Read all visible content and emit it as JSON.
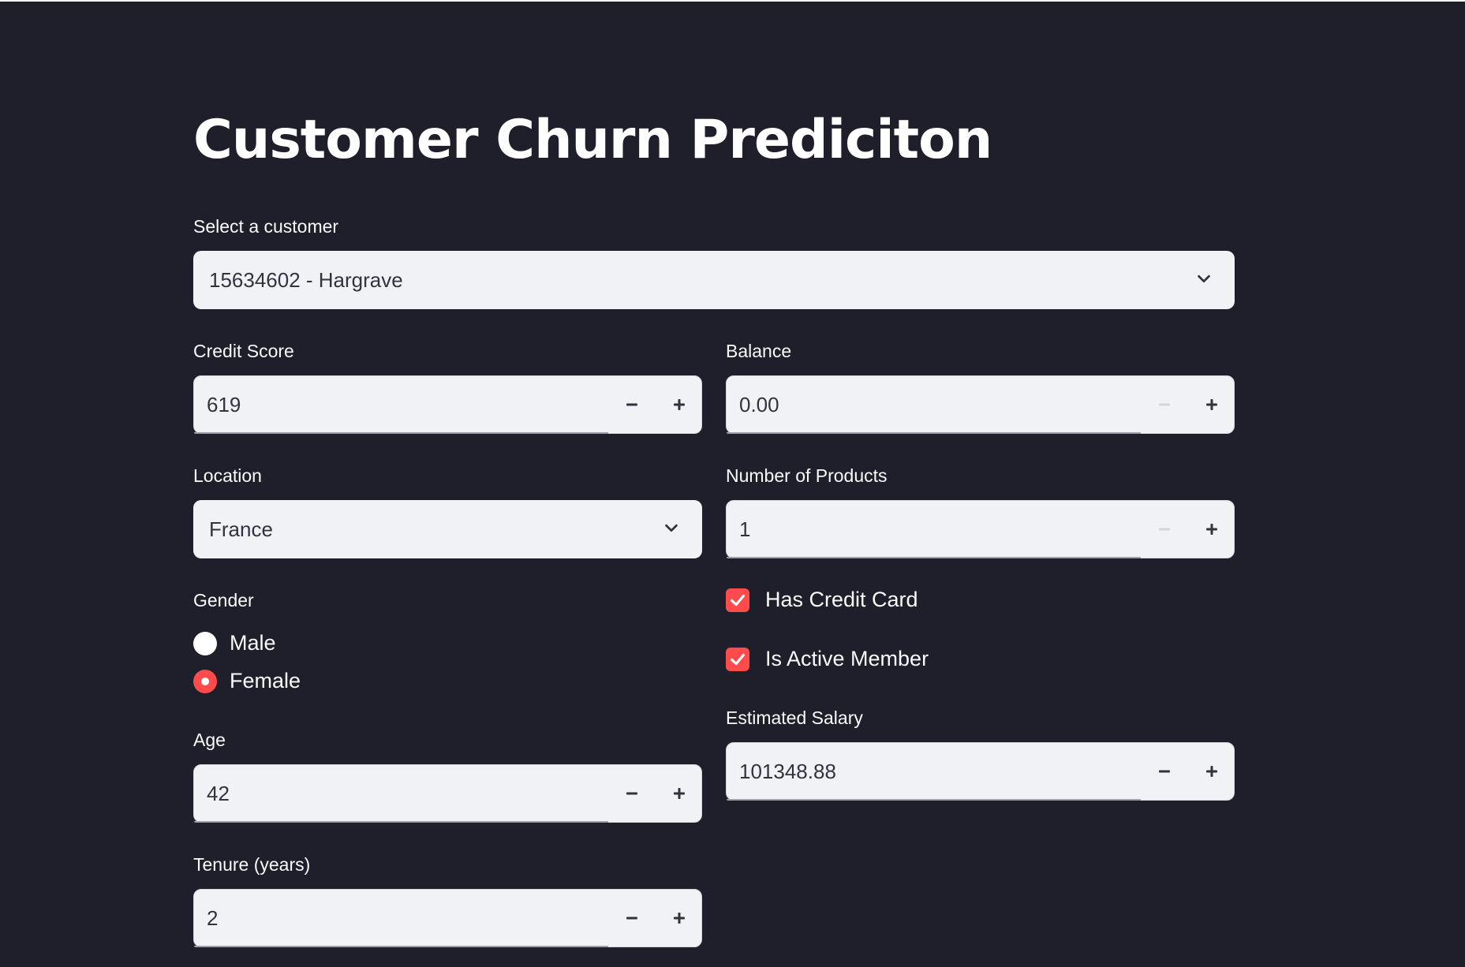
{
  "app": {
    "title": "Customer Churn Prediciton"
  },
  "customer_select": {
    "label": "Select a customer",
    "value": "15634602 - Hargrave",
    "icon": "chevron-down-icon"
  },
  "credit_score": {
    "label": "Credit Score",
    "value": "619"
  },
  "balance": {
    "label": "Balance",
    "value": "0.00"
  },
  "location": {
    "label": "Location",
    "value": "France",
    "icon": "chevron-down-icon"
  },
  "num_products": {
    "label": "Number of Products",
    "value": "1"
  },
  "gender": {
    "label": "Gender",
    "options": [
      "Male",
      "Female"
    ],
    "selected": "Female"
  },
  "has_credit_card": {
    "label": "Has Credit Card",
    "checked": true
  },
  "is_active_member": {
    "label": "Is Active Member",
    "checked": true
  },
  "age": {
    "label": "Age",
    "value": "42"
  },
  "estimated_salary": {
    "label": "Estimated Salary",
    "value": "101348.88"
  },
  "tenure": {
    "label": "Tenure (years)",
    "value": "2"
  },
  "colors": {
    "background": "#1f1f2c",
    "input_bg": "#f0f2f6",
    "accent": "#ff4b4b",
    "text": "#fafafa"
  }
}
